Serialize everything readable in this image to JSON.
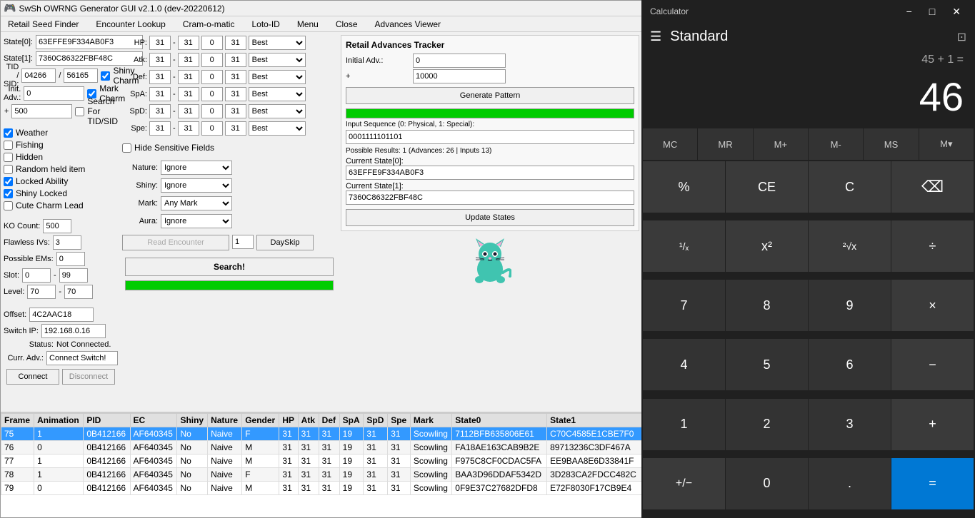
{
  "app": {
    "title": "SwSh OWRNG Generator GUI v2.1.0 (dev-20220612)"
  },
  "menu": {
    "items": [
      "Retail Seed Finder",
      "Encounter Lookup",
      "Cram-o-matic",
      "Loto-ID",
      "Menu",
      "Close",
      "Advances Viewer"
    ]
  },
  "left_panel": {
    "state0_label": "State[0]:",
    "state0_value": "63EFFE9F334AB0F3",
    "state1_label": "State[1]:",
    "state1_value": "7360C86322FBF48C",
    "tid_label": "TID / SID:",
    "tid_value": "04266",
    "sid_value": "56165",
    "shiny_charm_label": "Shiny Charm",
    "mark_charm_label": "Mark Charm",
    "init_adv_label": "Init. Adv.:",
    "init_adv_value": "0",
    "plus_value": "500",
    "search_for_tid_sid_label": "Search For TID/SID",
    "checkboxes": {
      "weather": "Weather",
      "fishing": "Fishing",
      "hidden": "Hidden",
      "random_held_item": "Random held item",
      "locked_ability": "Locked Ability",
      "shiny_locked": "Shiny Locked",
      "cute_charm_lead": "Cute Charm Lead"
    },
    "ko_count_label": "KO Count:",
    "ko_count_value": "500",
    "flawless_ivs_label": "Flawless IVs:",
    "flawless_ivs_value": "3",
    "possible_ems_label": "Possible EMs:",
    "possible_ems_value": "0",
    "slot_label": "Slot:",
    "slot_from": "0",
    "slot_to": "99",
    "level_label": "Level:",
    "level_from": "70",
    "level_to": "70",
    "offset_label": "Offset:",
    "offset_value": "4C2AAC18",
    "switch_ip_label": "Switch IP:",
    "switch_ip_value": "192.168.0.16",
    "status_label": "Status:",
    "status_value": "Not Connected.",
    "curr_adv_label": "Curr. Adv.:",
    "curr_adv_value": "Connect Switch!",
    "connect_btn": "Connect",
    "disconnect_btn": "Disconnect"
  },
  "iv_panel": {
    "hp_label": "HP:",
    "atk_label": "Atk:",
    "def_label": "Def:",
    "spa_label": "SpA:",
    "spd_label": "SpD:",
    "spe_label": "Spe:",
    "ivs": [
      {
        "min": "31",
        "dash": "-",
        "max": "31",
        "zero": "0",
        "best": "31",
        "filter": "Best"
      },
      {
        "min": "31",
        "dash": "-",
        "max": "31",
        "zero": "0",
        "best": "31",
        "filter": "Best"
      },
      {
        "min": "31",
        "dash": "-",
        "max": "31",
        "zero": "0",
        "best": "31",
        "filter": "Best"
      },
      {
        "min": "31",
        "dash": "-",
        "max": "31",
        "zero": "0",
        "best": "31",
        "filter": "Best"
      },
      {
        "min": "31",
        "dash": "-",
        "max": "31",
        "zero": "0",
        "best": "31",
        "filter": "Best"
      },
      {
        "min": "31",
        "dash": "-",
        "max": "31",
        "zero": "0",
        "best": "31",
        "filter": "Best"
      }
    ],
    "hide_sensitive_label": "Hide Sensitive Fields",
    "nature_label": "Nature:",
    "nature_value": "Ignore",
    "shiny_label": "Shiny:",
    "shiny_value": "Ignore",
    "mark_label": "Mark:",
    "mark_value": "Any Mark",
    "aura_label": "Aura:",
    "aura_value": "Ignore",
    "read_encounter_btn": "Read Encounter",
    "dayskip_num": "1",
    "dayskip_btn": "DaySkip",
    "search_btn": "Search!"
  },
  "tracker": {
    "title": "Retail Advances Tracker",
    "initial_adv_label": "Initial Adv.:",
    "initial_adv_value": "0",
    "plus_value": "10000",
    "generate_btn": "Generate Pattern",
    "input_sequence_label": "Input Sequence (0: Physical, 1: Special):",
    "input_sequence_value": "0001111101101",
    "possible_results_text": "Possible Results: 1 (Advances: 26 | Inputs 13)",
    "current_state0_label": "Current State[0]:",
    "current_state0_value": "63EFFE9F334AB0F3",
    "current_state1_label": "Current State[1]:",
    "current_state1_value": "7360C86322FBF48C",
    "update_btn": "Update States"
  },
  "table": {
    "columns": [
      "Frame",
      "Animation",
      "PID",
      "EC",
      "Shiny",
      "Nature",
      "Gender",
      "HP",
      "Atk",
      "Def",
      "SpA",
      "SpD",
      "Spe",
      "Mark",
      "State0",
      "State1"
    ],
    "rows": [
      {
        "frame": "75",
        "animation": "1",
        "pid": "0B412166",
        "ec": "AF640345",
        "shiny": "No",
        "nature": "Naive",
        "gender": "F",
        "hp": "31",
        "atk": "31",
        "def": "31",
        "spa": "19",
        "spd": "31",
        "spe": "31",
        "mark": "Scowling",
        "state0": "7112BFB635806E61",
        "state1": "C70C4585E1CBE7F0",
        "selected": true
      },
      {
        "frame": "76",
        "animation": "0",
        "pid": "0B412166",
        "ec": "AF640345",
        "shiny": "No",
        "nature": "Naive",
        "gender": "M",
        "hp": "31",
        "atk": "31",
        "def": "31",
        "spa": "19",
        "spd": "31",
        "spe": "31",
        "mark": "Scowling",
        "state0": "FA18AE163CAB9B2E",
        "state1": "89713236C3DF467A",
        "selected": false
      },
      {
        "frame": "77",
        "animation": "1",
        "pid": "0B412166",
        "ec": "AF640345",
        "shiny": "No",
        "nature": "Naive",
        "gender": "M",
        "hp": "31",
        "atk": "31",
        "def": "31",
        "spa": "19",
        "spd": "31",
        "spe": "31",
        "mark": "Scowling",
        "state0": "F975C8CF0CDAC5FA",
        "state1": "EE9BAA8E6D33841F",
        "selected": false
      },
      {
        "frame": "78",
        "animation": "1",
        "pid": "0B412166",
        "ec": "AF640345",
        "shiny": "No",
        "nature": "Naive",
        "gender": "F",
        "hp": "31",
        "atk": "31",
        "def": "31",
        "spa": "19",
        "spd": "31",
        "spe": "31",
        "mark": "Scowling",
        "state0": "BAA3D96DDAF5342D",
        "state1": "3D283CA2FDCC482C",
        "selected": false
      },
      {
        "frame": "79",
        "animation": "0",
        "pid": "0B412166",
        "ec": "AF640345",
        "shiny": "No",
        "nature": "Naive",
        "gender": "M",
        "hp": "31",
        "atk": "31",
        "def": "31",
        "spa": "19",
        "spd": "31",
        "spe": "31",
        "mark": "Scowling",
        "state0": "0F9E37C27682DFD8",
        "state1": "E72F8030F17CB9E4",
        "selected": false
      }
    ]
  },
  "calculator": {
    "title": "Calculator",
    "mode": "Standard",
    "expression": "45 + 1 =",
    "display": "46",
    "memory_buttons": [
      "MC",
      "MR",
      "M+",
      "M-",
      "MS",
      "M▾"
    ],
    "buttons": [
      [
        "%",
        "CE",
        "C",
        "⌫"
      ],
      [
        "¹/ₓ",
        "x²",
        "²√x",
        "÷"
      ],
      [
        "7",
        "8",
        "9",
        "×"
      ],
      [
        "4",
        "5",
        "6",
        "−"
      ],
      [
        "1",
        "2",
        "3",
        "+"
      ],
      [
        "+/−",
        "0",
        ".",
        "="
      ]
    ]
  },
  "colors": {
    "accent_blue": "#0078d4",
    "green_bar": "#00cc00",
    "selected_row_bg": "#3399ff",
    "selected_row_text": "#ffffff"
  }
}
